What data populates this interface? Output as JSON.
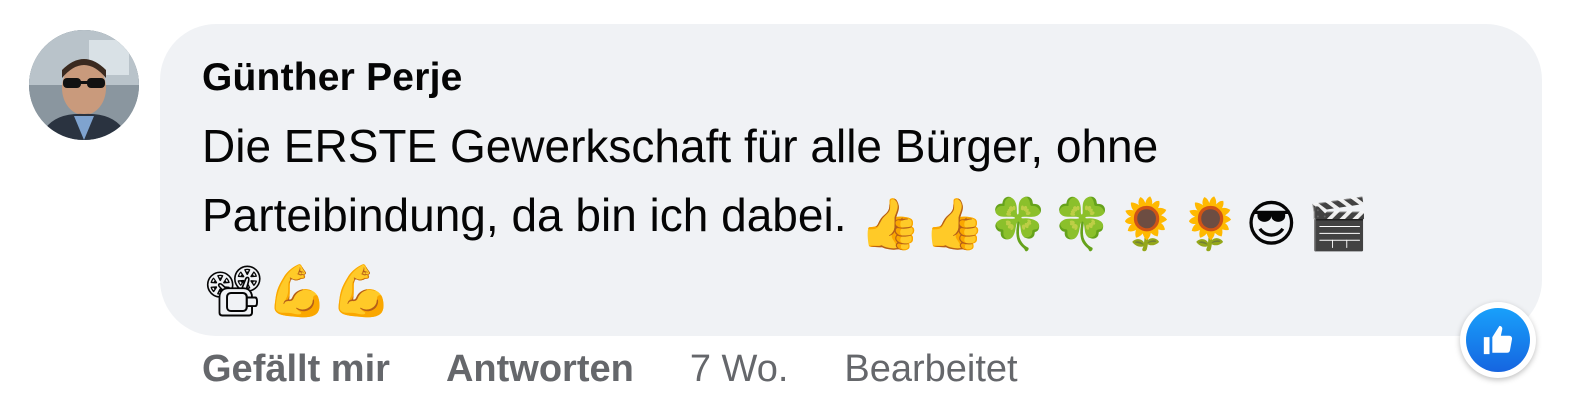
{
  "comment": {
    "author": "Günther Perje",
    "text_line1": "Die ERSTE Gewerkschaft für alle Bürger, ohne",
    "text_line2": "Parteibindung, da bin ich dabei.",
    "emojis_line2": [
      "👍",
      "👍",
      "🍀",
      "🍀",
      "🌻",
      "🌻",
      "😎",
      "🎬"
    ],
    "emojis_line3": [
      "📽",
      "💪",
      "💪"
    ]
  },
  "actions": {
    "like_label": "Gefällt mir",
    "reply_label": "Antworten",
    "timestamp": "7 Wo.",
    "edited_label": "Bearbeitet"
  },
  "reactions": {
    "icon": "thumbs-up-icon",
    "color": "#1877f2"
  }
}
